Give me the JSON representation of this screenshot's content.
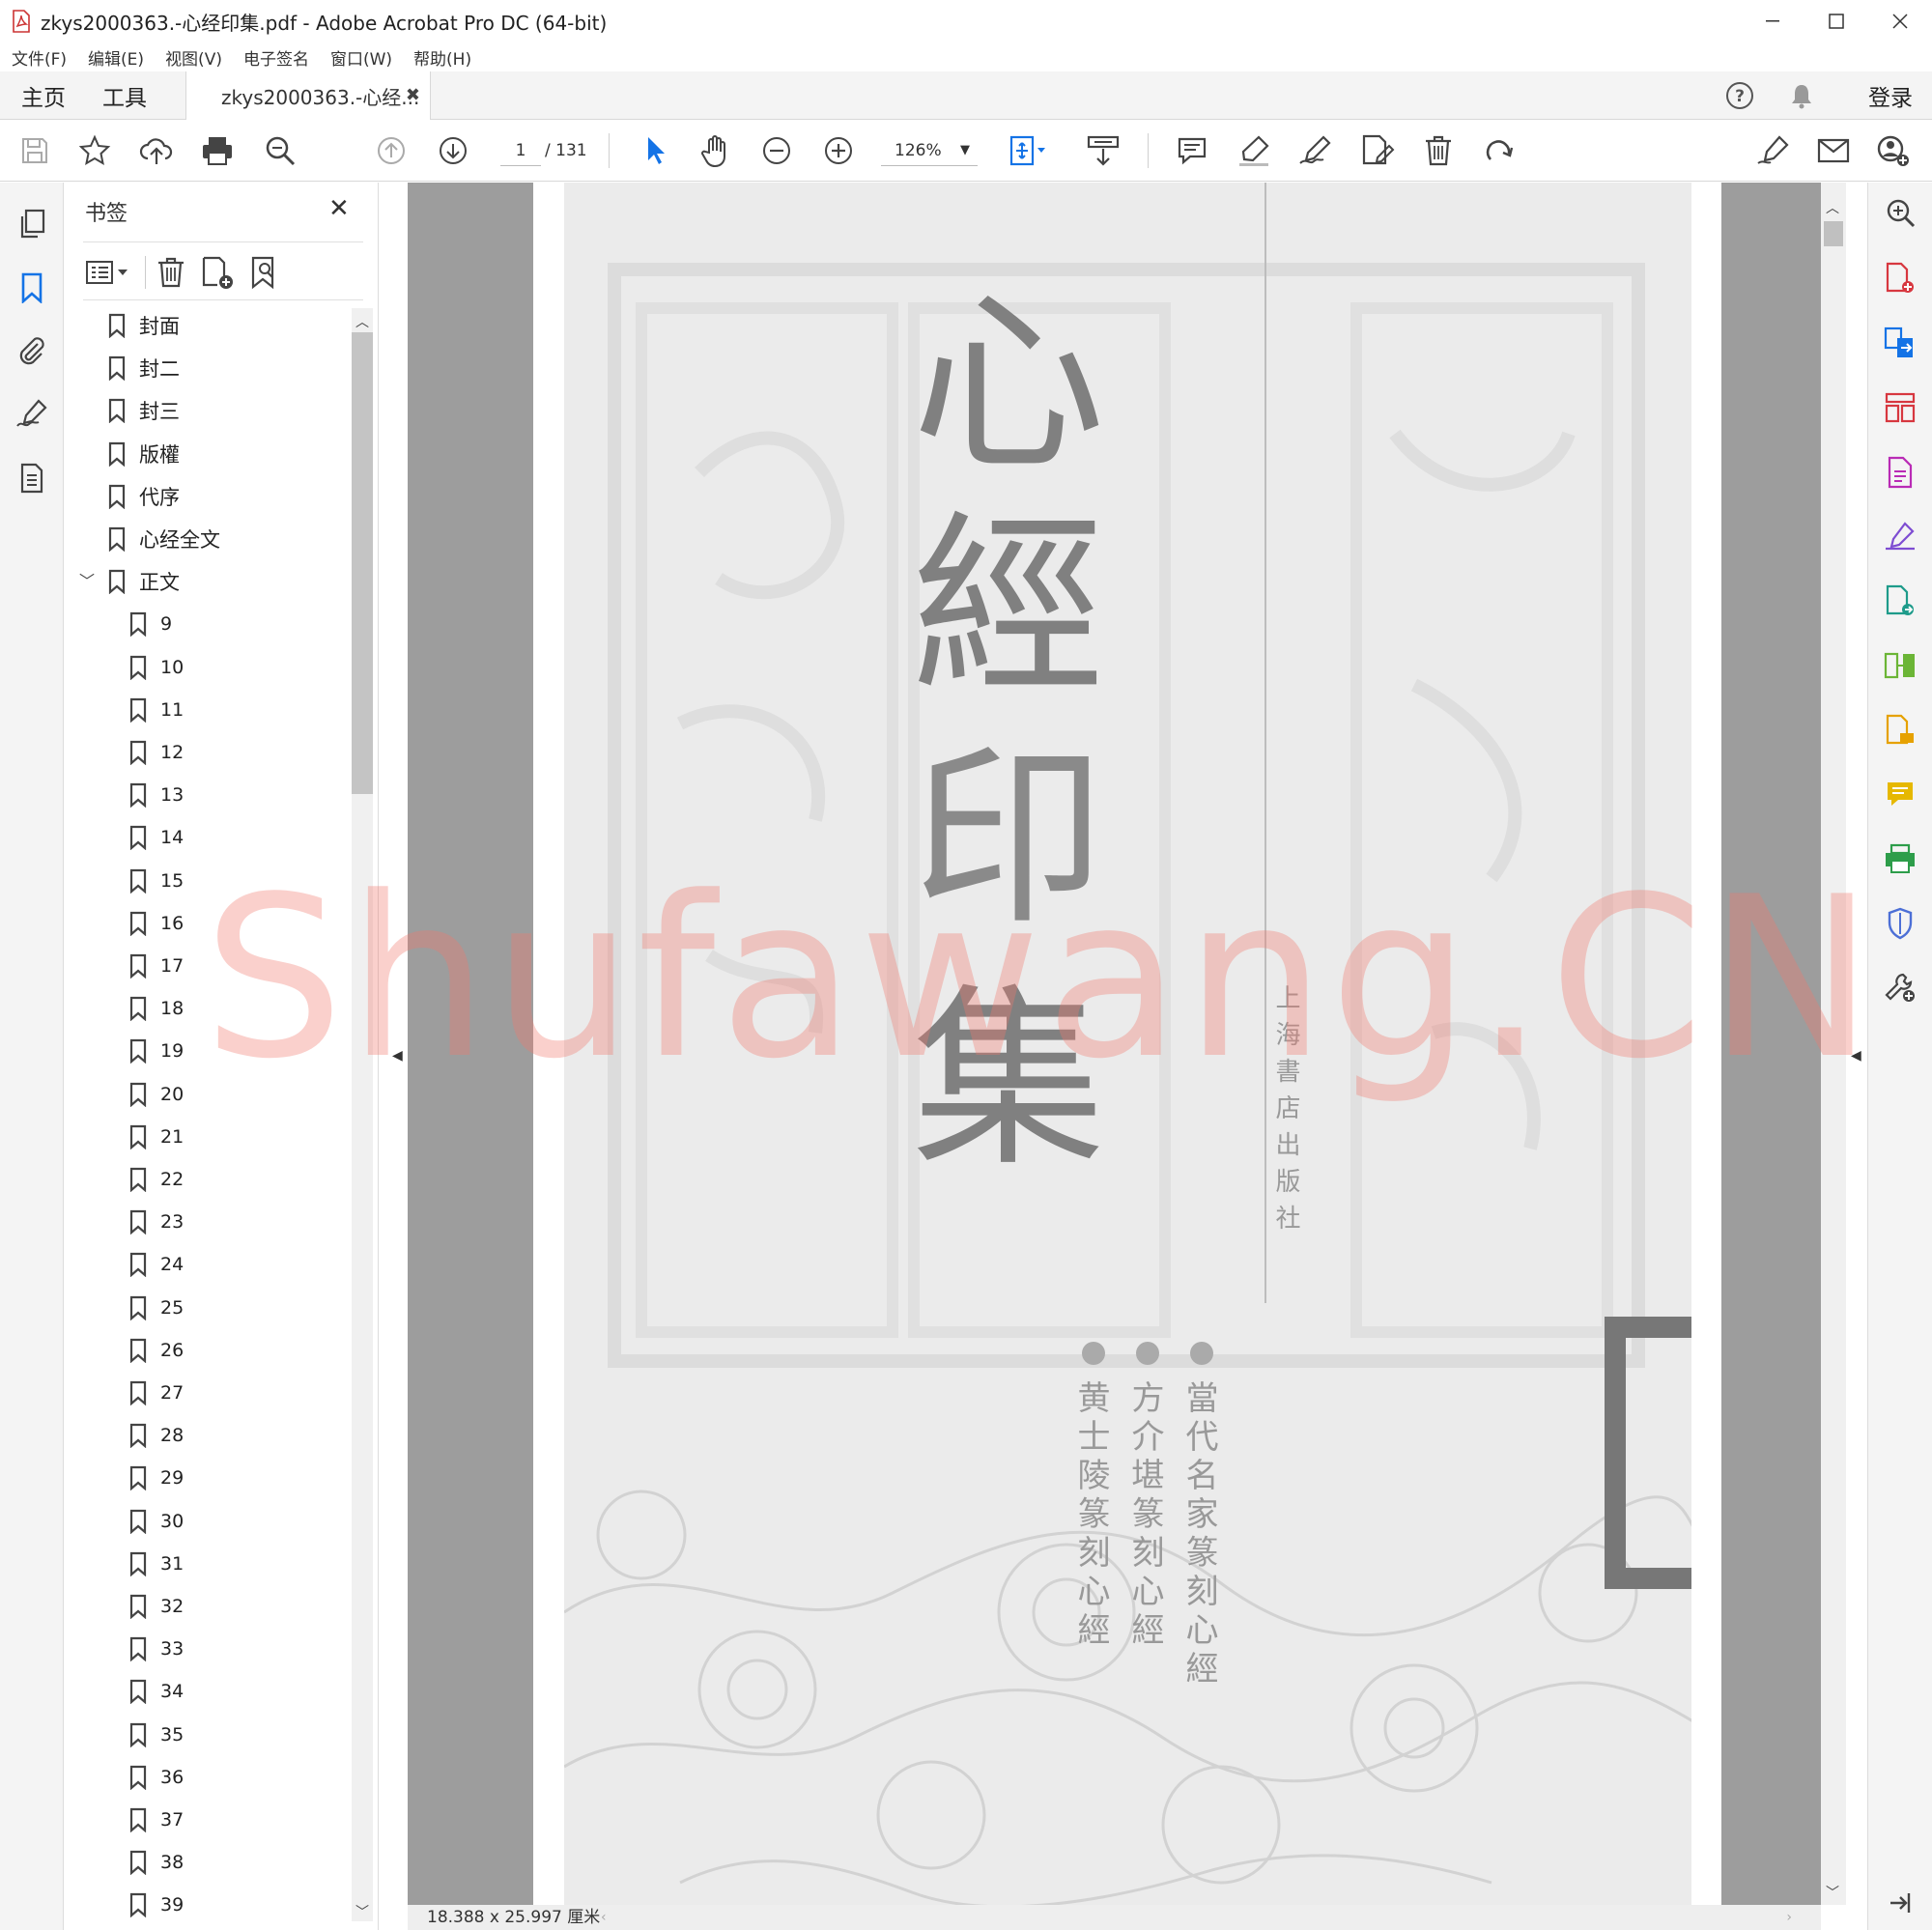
{
  "window": {
    "title": "zkys2000363.-心经印集.pdf - Adobe Acrobat Pro DC (64-bit)",
    "icon": "pdf-file-icon"
  },
  "menu": [
    "文件(F)",
    "编辑(E)",
    "视图(V)",
    "电子签名",
    "窗口(W)",
    "帮助(H)"
  ],
  "tabs": {
    "home": "主页",
    "tools": "工具",
    "document": "zkys2000363.-心经...",
    "signin": "登录"
  },
  "toolbar": {
    "page_current": "1",
    "page_total": "/ 131",
    "zoom": "126%"
  },
  "bookmarks": {
    "title": "书签",
    "top_items": [
      "封面",
      "封二",
      "封三",
      "版權",
      "代序",
      "心经全文",
      "正文"
    ],
    "children": [
      "9",
      "10",
      "11",
      "12",
      "13",
      "14",
      "15",
      "16",
      "17",
      "18",
      "19",
      "20",
      "21",
      "22",
      "23",
      "24",
      "25",
      "26",
      "27",
      "28",
      "29",
      "30",
      "31",
      "32",
      "33",
      "34",
      "35",
      "36",
      "37",
      "38",
      "39"
    ]
  },
  "document": {
    "cover_title": [
      "心",
      "經",
      "印",
      "集"
    ],
    "publisher": "上海書店出版社",
    "works": [
      "當代名家篆刻心經",
      "方介堪篆刻心經",
      "黄士陵篆刻心經"
    ]
  },
  "statusbar": {
    "page_size": "18.388 x 25.997 厘米"
  },
  "watermark": "Shufawang.CN",
  "colors": {
    "accent_blue": "#1473e6",
    "pdf_red": "#d7373f"
  }
}
